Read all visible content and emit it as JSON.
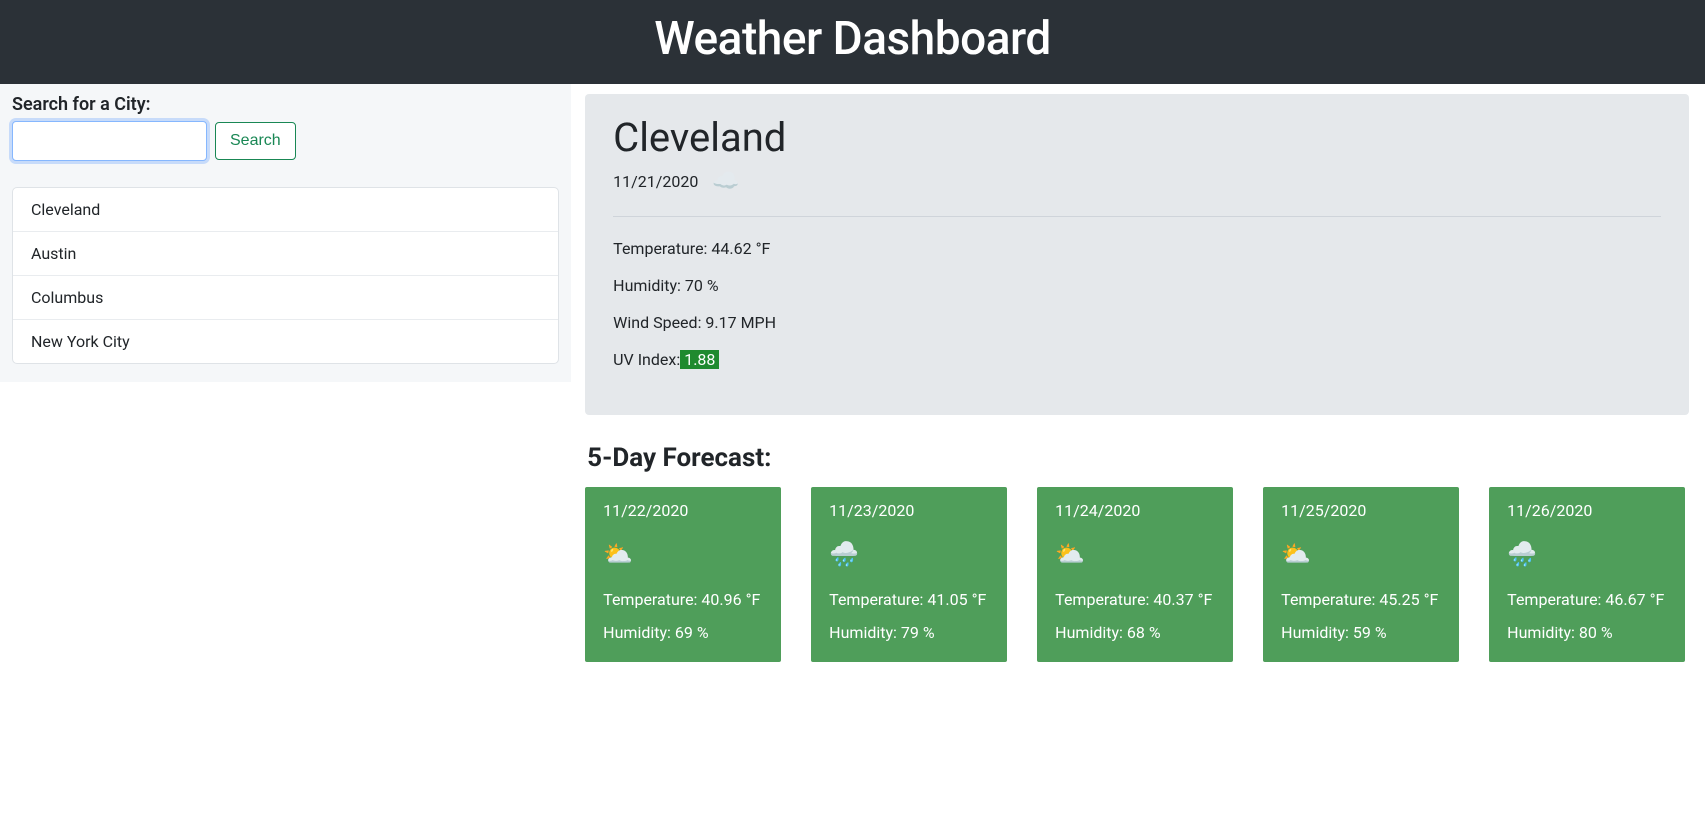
{
  "header": {
    "title": "Weather Dashboard"
  },
  "sidebar": {
    "label": "Search for a City:",
    "search_value": "",
    "search_placeholder": "",
    "search_button": "Search",
    "history": [
      "Cleveland",
      "Austin",
      "Columbus",
      "New York City"
    ]
  },
  "current": {
    "city": "Cleveland",
    "date": "11/21/2020",
    "icon_name": "cloud-icon",
    "icon_glyph": "☁️",
    "temp_label": "Temperature:",
    "temp_value": "44.62 °F",
    "humidity_label": "Humidity:",
    "humidity_value": "70 %",
    "wind_label": "Wind Speed:",
    "wind_value": "9.17 MPH",
    "uv_label": "UV Index:",
    "uv_value": "1.88",
    "uv_color": "#1f8a2f"
  },
  "forecast": {
    "title": "5-Day Forecast:",
    "temp_label": "Temperature:",
    "humidity_label": "Humidity:",
    "days": [
      {
        "date": "11/22/2020",
        "icon_name": "cloud-icon",
        "icon_glyph": "⛅",
        "temp": "40.96 °F",
        "humidity": "69 %"
      },
      {
        "date": "11/23/2020",
        "icon_name": "rain-icon",
        "icon_glyph": "🌧️",
        "temp": "41.05 °F",
        "humidity": "79 %"
      },
      {
        "date": "11/24/2020",
        "icon_name": "cloud-icon",
        "icon_glyph": "⛅",
        "temp": "40.37 °F",
        "humidity": "68 %"
      },
      {
        "date": "11/25/2020",
        "icon_name": "cloud-icon",
        "icon_glyph": "⛅",
        "temp": "45.25 °F",
        "humidity": "59 %"
      },
      {
        "date": "11/26/2020",
        "icon_name": "rain-icon",
        "icon_glyph": "🌧️",
        "temp": "46.67 °F",
        "humidity": "80 %"
      }
    ]
  }
}
